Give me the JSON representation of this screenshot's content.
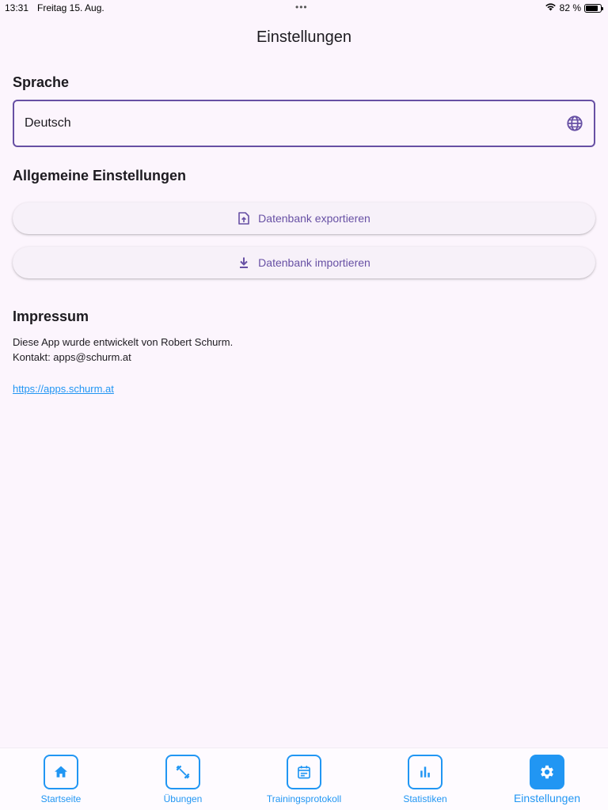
{
  "status": {
    "time": "13:31",
    "date": "Freitag 15. Aug.",
    "dots": "•••",
    "battery_percent": "82 %",
    "battery_level": 0.82
  },
  "app": {
    "title": "Einstellungen"
  },
  "language": {
    "heading": "Sprache",
    "selected": "Deutsch",
    "icon": "globe-icon"
  },
  "general": {
    "heading": "Allgemeine Einstellungen",
    "export_label": "Datenbank exportieren",
    "import_label": "Datenbank importieren"
  },
  "impressum": {
    "heading": "Impressum",
    "line1": "Diese App wurde entwickelt von Robert Schurm.",
    "line2": "Kontakt: apps@schurm.at",
    "link": "https://apps.schurm.at"
  },
  "nav": {
    "items": [
      {
        "label": "Startseite",
        "icon": "home-icon"
      },
      {
        "label": "Übungen",
        "icon": "fitness-icon"
      },
      {
        "label": "Trainingsprotokoll",
        "icon": "calendar-icon"
      },
      {
        "label": "Statistiken",
        "icon": "bar-chart-icon"
      },
      {
        "label": "Einstellungen",
        "icon": "gear-icon",
        "active": true
      }
    ]
  },
  "colors": {
    "accent": "#6750a4",
    "nav_blue": "#2196f3",
    "background": "#fcf5fd"
  }
}
